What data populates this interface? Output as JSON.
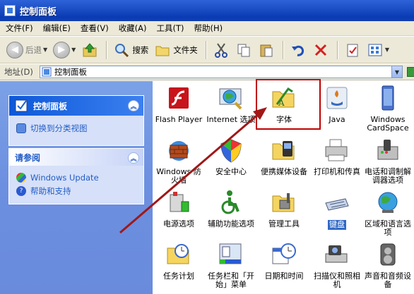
{
  "window": {
    "title": "控制面板"
  },
  "menu": [
    "文件(F)",
    "编辑(E)",
    "查看(V)",
    "收藏(A)",
    "工具(T)",
    "帮助(H)"
  ],
  "toolbar": {
    "back": "后退",
    "search": "搜索",
    "folders": "文件夹"
  },
  "address": {
    "label": "地址(D)",
    "value": "控制面板"
  },
  "left": {
    "panel1": {
      "title": "控制面板",
      "link": "切换到分类视图"
    },
    "panel2": {
      "title": "请参阅",
      "links": [
        "Windows Update",
        "帮助和支持"
      ]
    }
  },
  "items": [
    {
      "name": "Flash Player",
      "icon": "flash-icon"
    },
    {
      "name": "Internet 选项",
      "icon": "internet-options-icon"
    },
    {
      "name": "字体",
      "icon": "fonts-folder-icon"
    },
    {
      "name": "Java",
      "icon": "java-icon"
    },
    {
      "name": "Windows CardSpace",
      "icon": "cardspace-icon"
    },
    {
      "name": "Windows 防火墙",
      "icon": "firewall-icon"
    },
    {
      "name": "安全中心",
      "icon": "security-center-icon"
    },
    {
      "name": "便携媒体设备",
      "icon": "portable-media-icon"
    },
    {
      "name": "打印机和传真",
      "icon": "printer-icon"
    },
    {
      "name": "电话和调制解调器选项",
      "icon": "phone-modem-icon"
    },
    {
      "name": "电源选项",
      "icon": "power-options-icon"
    },
    {
      "name": "辅助功能选项",
      "icon": "accessibility-icon"
    },
    {
      "name": "管理工具",
      "icon": "admin-tools-icon"
    },
    {
      "name": "键盘",
      "icon": "keyboard-icon"
    },
    {
      "name": "区域和语言选项",
      "icon": "region-language-icon"
    },
    {
      "name": "任务计划",
      "icon": "scheduled-tasks-icon"
    },
    {
      "name": "任务栏和「开始」菜单",
      "icon": "taskbar-icon"
    },
    {
      "name": "日期和时间",
      "icon": "date-time-icon"
    },
    {
      "name": "扫描仪和照相机",
      "icon": "scanner-camera-icon"
    },
    {
      "name": "声音和音频设备",
      "icon": "sound-icon"
    }
  ],
  "colors": {
    "accent": "#215dc6",
    "annotation": "#c00000",
    "selection": "#3169c6"
  }
}
